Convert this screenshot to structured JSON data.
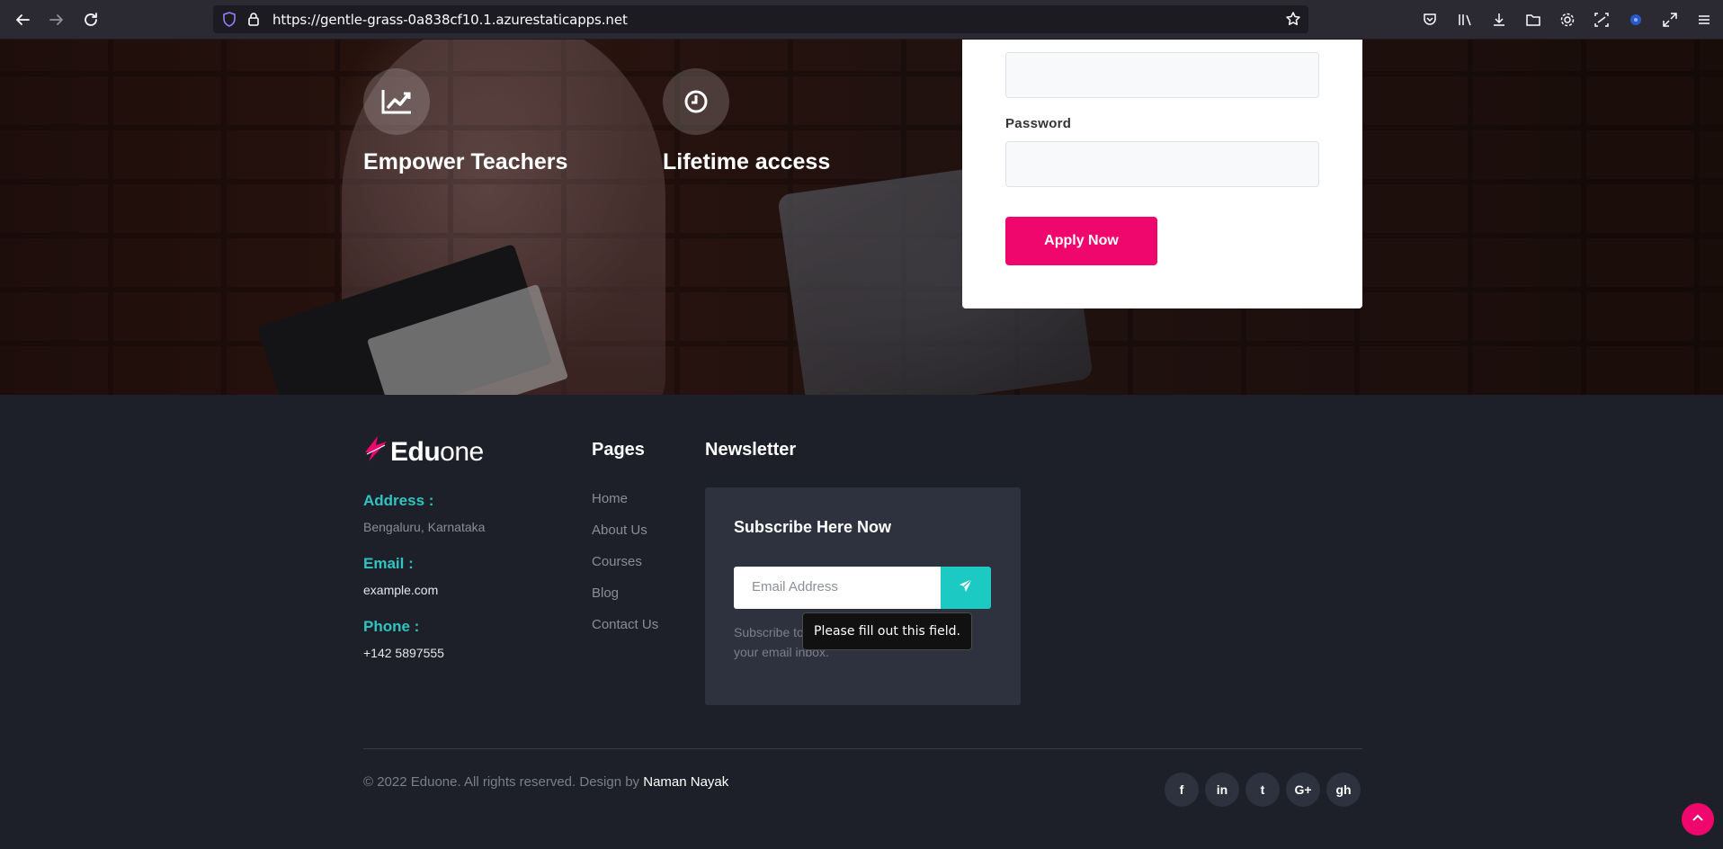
{
  "browser": {
    "url": "https://gentle-grass-0a838cf10.1.azurestaticapps.net",
    "icons": [
      "back-icon",
      "forward-icon",
      "reload-icon",
      "shield-icon",
      "lock-icon",
      "bookmark-star-icon",
      "save-to-pocket-icon",
      "library-icon",
      "downloads-icon",
      "folder-icon",
      "settings-icon",
      "screenshot-icon",
      "extension-icon",
      "fullscreen-icon",
      "menu-icon"
    ]
  },
  "hero": {
    "features": [
      {
        "title": "Empower Teachers",
        "icon": "chart-line-icon"
      },
      {
        "title": "Lifetime access",
        "icon": "clock-icon"
      }
    ],
    "form": {
      "password_label": "Password",
      "apply_label": "Apply Now"
    }
  },
  "footer": {
    "brand": {
      "bold": "Edu",
      "light": "one"
    },
    "contact": {
      "address_label": "Address :",
      "address_value": "Bengaluru, Karnataka",
      "email_label": "Email :",
      "email_value": "example.com",
      "phone_label": "Phone :",
      "phone_value": "+142 5897555"
    },
    "pages": {
      "title": "Pages",
      "links": [
        "Home",
        "About Us",
        "Courses",
        "Blog",
        "Contact Us"
      ]
    },
    "newsletter": {
      "title": "Newsletter",
      "box_title": "Subscribe Here Now",
      "email_placeholder": "Email Address",
      "description": "Subscribe to get the latest updates to your email inbox.",
      "tooltip": "Please fill out this field."
    },
    "copyright": {
      "text": "© 2022 Eduone. All rights reserved. Design by ",
      "author": "Naman Nayak"
    },
    "social": [
      {
        "icon": "facebook-icon",
        "glyph": "f"
      },
      {
        "icon": "linkedin-icon",
        "glyph": "in"
      },
      {
        "icon": "twitter-icon",
        "glyph": "t"
      },
      {
        "icon": "google-plus-icon",
        "glyph": "G+"
      },
      {
        "icon": "github-icon",
        "glyph": "gh"
      }
    ]
  },
  "colors": {
    "accent_pink": "#f0076d",
    "accent_teal": "#2fc4c1",
    "footer_bg": "#1d2029"
  }
}
